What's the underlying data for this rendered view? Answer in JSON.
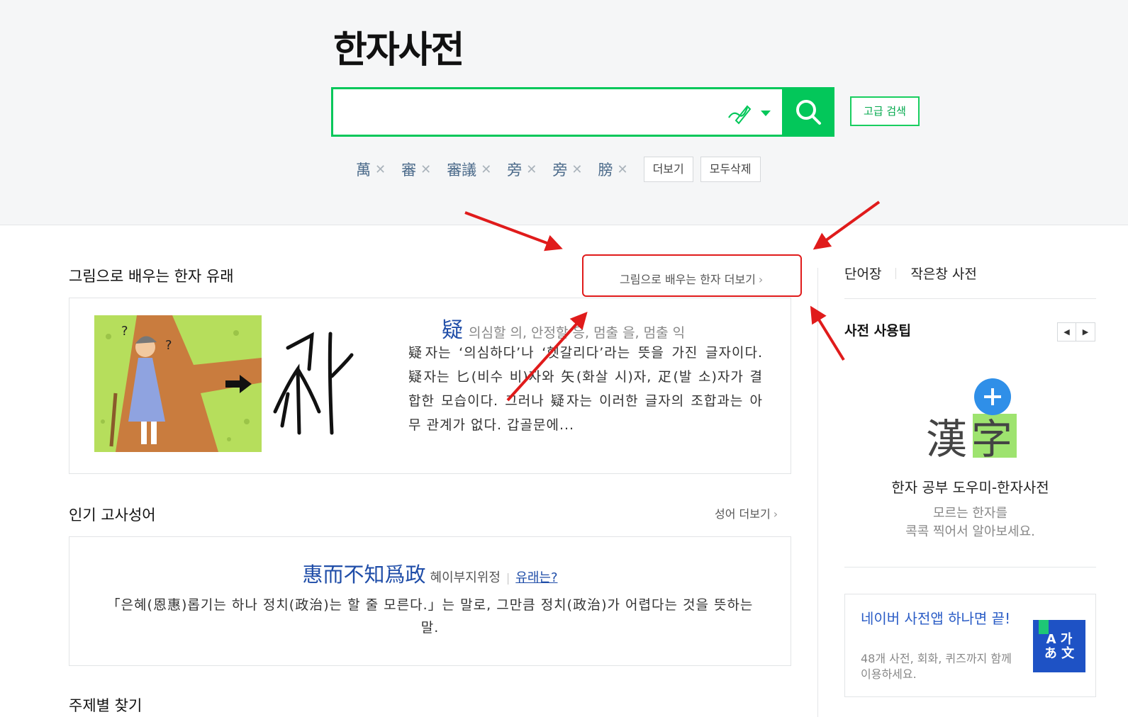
{
  "header": {
    "logo": "한자사전",
    "search": {
      "value": "",
      "placeholder": ""
    },
    "advanced_search": "고급 검색",
    "recent": [
      "萬",
      "審",
      "審議",
      "旁",
      "旁",
      "膀"
    ],
    "more": "더보기",
    "delete_all": "모두삭제"
  },
  "etymology": {
    "title": "그림으로 배우는 한자 유래",
    "more": "그림으로 배우는 한자 더보기",
    "char": "疑",
    "readings": "의심할 의, 안정할 응, 멈출 을, 멈출 익",
    "description": "疑자는 ‘의심하다’나 ‘헷갈리다’라는 뜻을 가진 글자이다. 疑자는 匕(비수 비)자와 矢(화살 시)자, 疋(발 소)자가 결합한 모습이다. 그러나 疑자는 이러한 글자의 조합과는 아무 관계가 없다. 갑골문에..."
  },
  "idiom": {
    "title": "인기 고사성어",
    "more": "성어 더보기",
    "text": "惠而不知爲政",
    "reading": "혜이부지위정",
    "origin_link": "유래는?",
    "meaning": "「은혜(恩惠)롭기는 하나 정치(政治)는 할 줄 모른다.」는 말로, 그만큼 정치(政治)가 어렵다는 것을 뜻하는 말."
  },
  "next_section": {
    "title": "주제별 찾기"
  },
  "sidebar": {
    "links": [
      "단어장",
      "작은창 사전"
    ],
    "tips_title": "사전 사용팁",
    "pager": {
      "prev": "◀",
      "next": "▶"
    },
    "promo": {
      "char1": "漢",
      "char2": "字",
      "title": "한자 공부 도우미-한자사전",
      "subtitle_line1": "모르는 한자를",
      "subtitle_line2": "콕콕 찍어서 알아보세요."
    },
    "app": {
      "title": "네이버 사전앱 하나면 끝!",
      "subtitle": "48개 사전, 회화, 퀴즈까지 함께 이용하세요.",
      "icon_line1": "A 가",
      "icon_line2": "あ 文"
    }
  },
  "colors": {
    "brand_green": "#03c75a",
    "link_blue": "#1f4da8",
    "annotation_red": "#e01b1b"
  }
}
